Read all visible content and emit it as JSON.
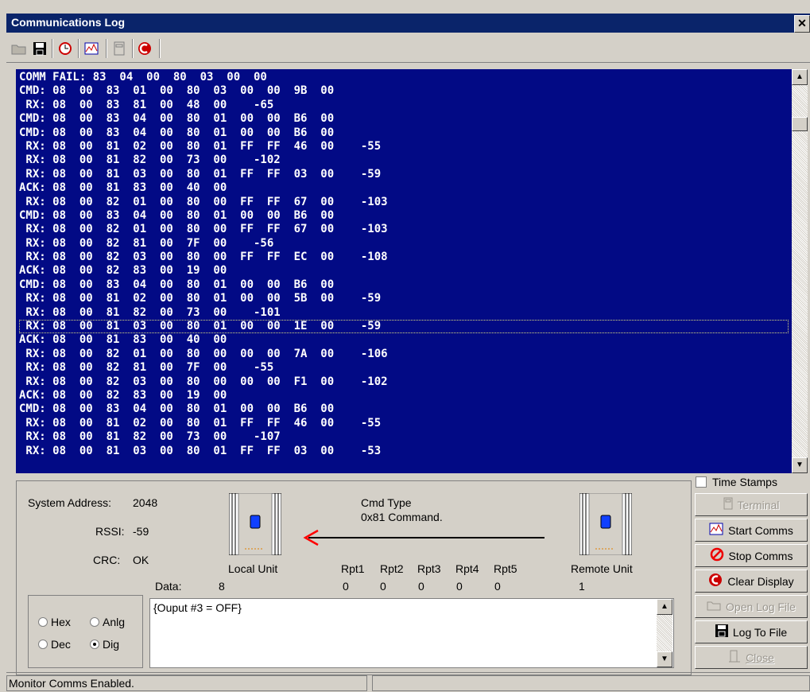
{
  "window": {
    "title": "Communications Log",
    "close_label": "✕"
  },
  "toolbar": {
    "icons": [
      "open-folder-icon",
      "save-disk-icon",
      "clock-icon",
      "chart-icon",
      "terminal-icon",
      "clear-display-icon"
    ]
  },
  "log": {
    "lines": [
      "COMM FAIL: 83  04  00  80  03  00  00",
      "CMD: 08  00  83  01  00  80  03  00  00  9B  00",
      " RX: 08  00  83  81  00  48  00    -65",
      "CMD: 08  00  83  04  00  80  01  00  00  B6  00",
      "CMD: 08  00  83  04  00  80  01  00  00  B6  00",
      " RX: 08  00  81  02  00  80  01  FF  FF  46  00    -55",
      " RX: 08  00  81  82  00  73  00    -102",
      " RX: 08  00  81  03  00  80  01  FF  FF  03  00    -59",
      "ACK: 08  00  81  83  00  40  00",
      " RX: 08  00  82  01  00  80  00  FF  FF  67  00    -103",
      "CMD: 08  00  83  04  00  80  01  00  00  B6  00",
      " RX: 08  00  82  01  00  80  00  FF  FF  67  00    -103",
      " RX: 08  00  82  81  00  7F  00    -56",
      " RX: 08  00  82  03  00  80  00  FF  FF  EC  00    -108",
      "ACK: 08  00  82  83  00  19  00",
      "CMD: 08  00  83  04  00  80  01  00  00  B6  00",
      " RX: 08  00  81  02  00  80  01  00  00  5B  00    -59",
      " RX: 08  00  81  82  00  73  00    -101",
      " RX: 08  00  81  03  00  80  01  00  00  1E  00    -59",
      "ACK: 08  00  81  83  00  40  00",
      " RX: 08  00  82  01  00  80  00  00  00  7A  00    -106",
      " RX: 08  00  82  81  00  7F  00    -55",
      " RX: 08  00  82  03  00  80  00  00  00  F1  00    -102",
      "ACK: 08  00  82  83  00  19  00",
      "CMD: 08  00  83  04  00  80  01  00  00  B6  00",
      " RX: 08  00  81  02  00  80  01  FF  FF  46  00    -55",
      " RX: 08  00  81  82  00  73  00    -107",
      " RX: 08  00  81  03  00  80  01  FF  FF  03  00    -53"
    ],
    "selected_index": 18,
    "background_color": "#020a85",
    "text_color": "#ffffff"
  },
  "info": {
    "system_address_label": "System Address:",
    "system_address_value": "2048",
    "rssi_label": "RSSI:",
    "rssi_value": "-59",
    "crc_label": "CRC:",
    "crc_value": "OK",
    "local_unit_label": "Local Unit",
    "remote_unit_label": "Remote Unit",
    "cmd_type_label": "Cmd Type",
    "cmd_type_value": "0x81  Command.",
    "data_label": "Data:",
    "data_value": "8",
    "repeaters": [
      {
        "label": "Rpt1",
        "value": "0"
      },
      {
        "label": "Rpt2",
        "value": "0"
      },
      {
        "label": "Rpt3",
        "value": "0"
      },
      {
        "label": "Rpt4",
        "value": "0"
      },
      {
        "label": "Rpt5",
        "value": "0"
      }
    ],
    "remote_value": "1",
    "arrow_color": "#ff0000"
  },
  "format": {
    "options": [
      {
        "label": "Hex",
        "checked": false
      },
      {
        "label": "Anlg",
        "checked": false
      },
      {
        "label": "Dec",
        "checked": false
      },
      {
        "label": "Dig",
        "checked": true
      }
    ]
  },
  "note": {
    "text": "{Ouput #3 = OFF}"
  },
  "side": {
    "time_stamps_label": "Time Stamps",
    "time_stamps_checked": false,
    "buttons": [
      {
        "label": "Terminal",
        "icon": "terminal-icon",
        "enabled": false
      },
      {
        "label": "Start Comms",
        "icon": "chart-icon",
        "enabled": true
      },
      {
        "label": "Stop Comms",
        "icon": "stop-icon",
        "enabled": true
      },
      {
        "label": "Clear Display",
        "icon": "clear-display-icon",
        "enabled": true
      },
      {
        "label": "Open Log File",
        "icon": "open-folder-icon",
        "enabled": false
      },
      {
        "label": "Log To File",
        "icon": "save-disk-icon",
        "enabled": true
      },
      {
        "label": "Close",
        "icon": "close-door-icon",
        "enabled": false
      }
    ]
  },
  "status": {
    "text": "Monitor Comms Enabled.",
    "text2": ""
  }
}
